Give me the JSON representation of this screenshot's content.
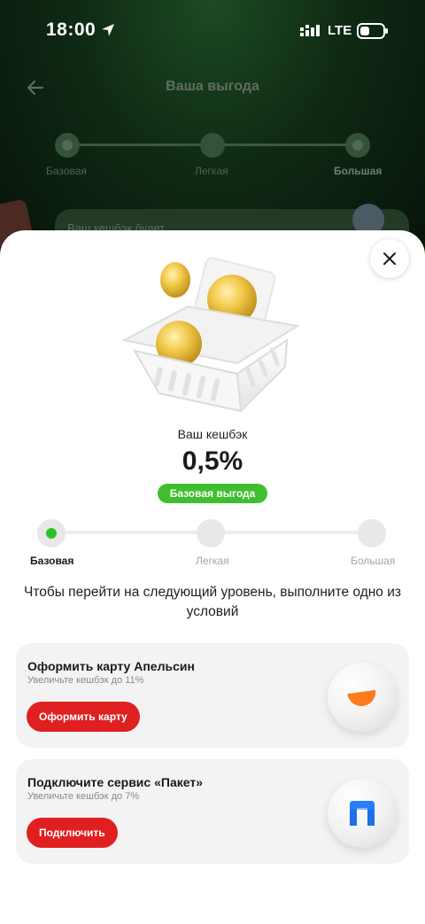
{
  "status_bar": {
    "time": "18:00",
    "network": "LTE"
  },
  "background_page": {
    "title": "Ваша выгода",
    "levels": [
      "Базовая",
      "Легкая",
      "Большая"
    ],
    "card_text": "Ваш кешбэк будет"
  },
  "sheet": {
    "cashback_label": "Ваш кешбэк",
    "cashback_value": "0,5%",
    "badge": "Базовая выгода",
    "levels": [
      "Базовая",
      "Легкая",
      "Большая"
    ],
    "active_level": 0,
    "instruction": "Чтобы перейти на следующий уровень, выполните одно из условий",
    "offers": [
      {
        "title": "Оформить карту Апельсин",
        "subtitle": "Увеличьте кешбэк до 11%",
        "button": "Оформить карту",
        "icon": "orange-slice-icon"
      },
      {
        "title": "Подключите сервис «Пакет»",
        "subtitle": "Увеличьте кешбэк до 7%",
        "button": "Подключить",
        "icon": "paket-logo-icon"
      }
    ]
  },
  "colors": {
    "accent_green": "#3fbf2e",
    "button_red": "#e02020",
    "background_dark_green": "#0f2a14"
  }
}
